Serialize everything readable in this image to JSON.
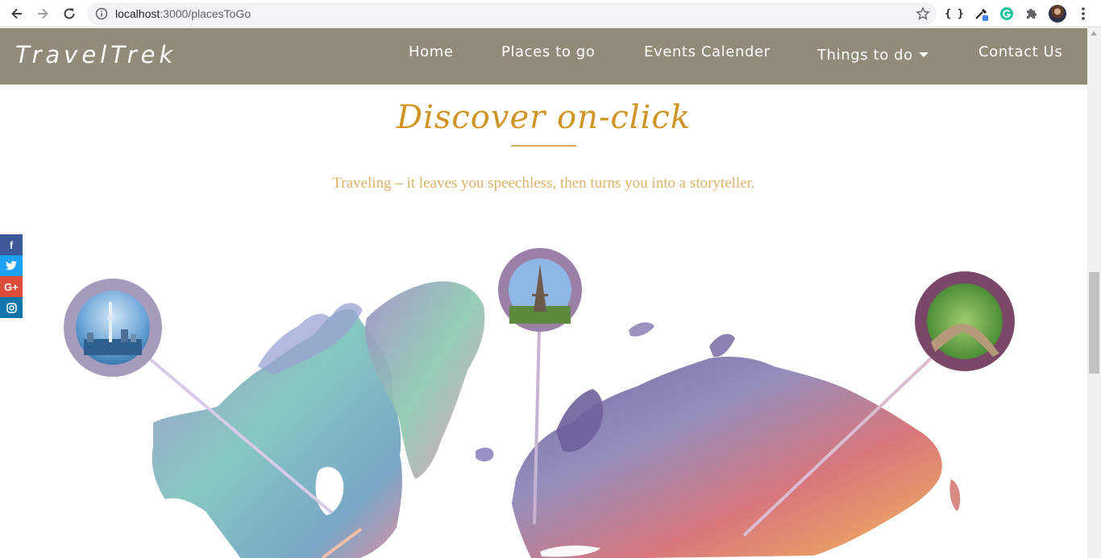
{
  "browser": {
    "url_host": "localhost",
    "url_path": ":3000/placesToGo",
    "extensions": [
      "{ }"
    ]
  },
  "site": {
    "brand": "TravelTrek",
    "nav": [
      {
        "label": "Home"
      },
      {
        "label": "Places to go"
      },
      {
        "label": "Events Calender"
      },
      {
        "label": "Things to do",
        "dropdown": true
      },
      {
        "label": "Contact Us"
      }
    ],
    "colors": {
      "navbar": "#938b7a",
      "title": "#cf9424",
      "tagline": "#dbb369"
    }
  },
  "hero": {
    "title": "Discover on-click",
    "tagline": "Traveling – it leaves you speechless, then turns you into a storyteller."
  },
  "social": [
    {
      "name": "facebook-icon",
      "glyph": "f",
      "color": "#3b5998"
    },
    {
      "name": "twitter-icon",
      "glyph": "t",
      "color": "#1da1f2"
    },
    {
      "name": "google-plus-icon",
      "glyph": "G+",
      "color": "#dd4b39"
    },
    {
      "name": "instagram-icon",
      "glyph": "◎",
      "color": "#0e76a8"
    }
  ],
  "pins": [
    {
      "place": "toronto-cn-tower",
      "ring": "#a79bbb",
      "line": "#d8cbe9"
    },
    {
      "place": "paris-eiffel-tower",
      "ring": "#9b7fa6",
      "line": "#c7b2d2"
    },
    {
      "place": "great-wall-of-china",
      "ring": "#7a4866",
      "line": "#dcbcd0"
    }
  ]
}
